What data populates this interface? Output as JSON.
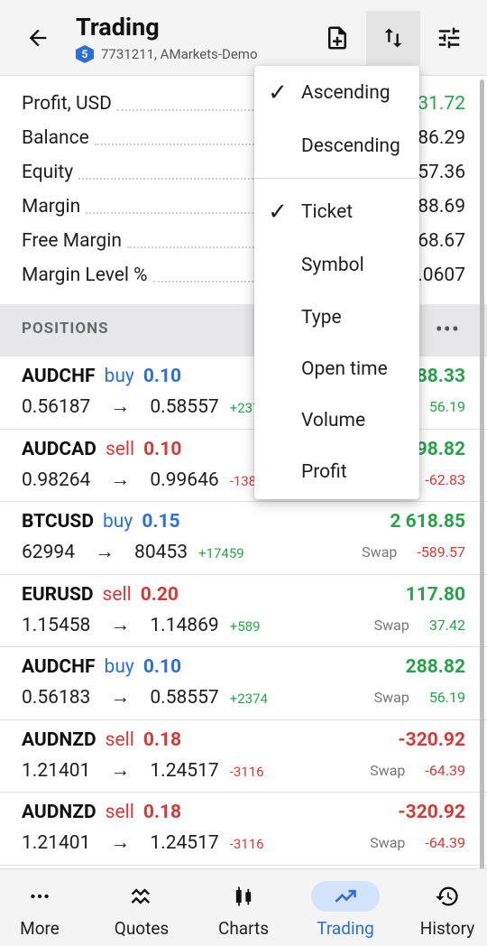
{
  "header": {
    "title": "Trading",
    "account_badge": "5",
    "account_text": "7731211, AMarkets-Demo",
    "icons": [
      "back-arrow-icon",
      "new-order-icon",
      "sort-icon",
      "filter-settings-icon"
    ]
  },
  "summary": [
    {
      "label": "Profit, USD",
      "value": "31.72",
      "green": true
    },
    {
      "label": "Balance",
      "value": "86.29"
    },
    {
      "label": "Equity",
      "value": "57.36"
    },
    {
      "label": "Margin",
      "value": "88.69"
    },
    {
      "label": "Free Margin",
      "value": "68.67"
    },
    {
      "label": "Margin Level %",
      "value": ".0607"
    }
  ],
  "positions_header": {
    "title": "POSITIONS",
    "more": "•••"
  },
  "positions": [
    {
      "symbol": "AUDCHF",
      "type": "buy",
      "volume": "0.10",
      "open": "0.56187",
      "current": "0.58557",
      "points": "+237",
      "profit": "88.33",
      "swap_label": "",
      "swap": "56.19"
    },
    {
      "symbol": "AUDCAD",
      "type": "sell",
      "volume": "0.10",
      "open": "0.98264",
      "current": "0.99646",
      "points": "-1382",
      "profit": "98.82",
      "swap_label": "",
      "swap": "-62.83"
    },
    {
      "symbol": "BTCUSD",
      "type": "buy",
      "volume": "0.15",
      "open": "62994",
      "current": "80453",
      "points": "+17459",
      "profit": "2 618.85",
      "swap_label": "Swap",
      "swap": "-589.57"
    },
    {
      "symbol": "EURUSD",
      "type": "sell",
      "volume": "0.20",
      "open": "1.15458",
      "current": "1.14869",
      "points": "+589",
      "profit": "117.80",
      "swap_label": "Swap",
      "swap": "37.42"
    },
    {
      "symbol": "AUDCHF",
      "type": "buy",
      "volume": "0.10",
      "open": "0.56183",
      "current": "0.58557",
      "points": "+2374",
      "profit": "288.82",
      "swap_label": "Swap",
      "swap": "56.19"
    },
    {
      "symbol": "AUDNZD",
      "type": "sell",
      "volume": "0.18",
      "open": "1.21401",
      "current": "1.24517",
      "points": "-3116",
      "profit": "-320.92",
      "swap_label": "Swap",
      "swap": "-64.39"
    },
    {
      "symbol": "AUDNZD",
      "type": "sell",
      "volume": "0.18",
      "open": "1.21401",
      "current": "1.24517",
      "points": "-3116",
      "profit": "-320.92",
      "swap_label": "Swap",
      "swap": "-64.39"
    }
  ],
  "arrow_glyph": "→",
  "sort_menu": {
    "order_items": [
      {
        "label": "Ascending",
        "checked": true
      },
      {
        "label": "Descending",
        "checked": false
      }
    ],
    "field_items": [
      {
        "label": "Ticket",
        "checked": true
      },
      {
        "label": "Symbol",
        "checked": false
      },
      {
        "label": "Type",
        "checked": false
      },
      {
        "label": "Open time",
        "checked": false
      },
      {
        "label": "Volume",
        "checked": false
      },
      {
        "label": "Profit",
        "checked": false
      }
    ],
    "check_glyph": "✓"
  },
  "bottom_nav": [
    {
      "label": "More",
      "icon": "more-dots-icon",
      "active": false
    },
    {
      "label": "Quotes",
      "icon": "quotes-icon",
      "active": false
    },
    {
      "label": "Charts",
      "icon": "candlestick-icon",
      "active": false
    },
    {
      "label": "Trading",
      "icon": "trend-line-icon",
      "active": true
    },
    {
      "label": "History",
      "icon": "history-clock-icon",
      "active": false
    }
  ],
  "colors": {
    "accent_blue": "#2d6fd6",
    "profit_green": "#2aa14b",
    "loss_red": "#d23a3a"
  }
}
